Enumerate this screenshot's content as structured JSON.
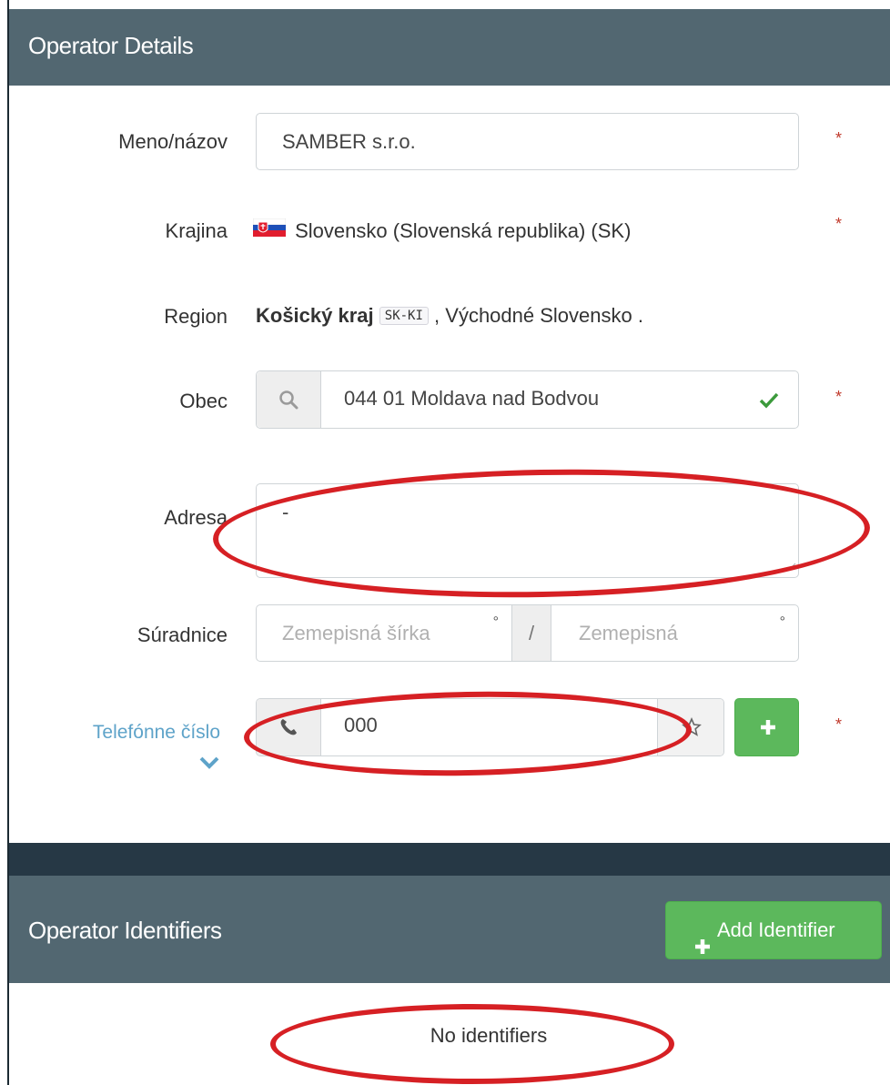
{
  "operator_details": {
    "title": "Operator Details",
    "name": {
      "label": "Meno/názov",
      "value": "SAMBER s.r.o.",
      "required_mark": "*"
    },
    "country": {
      "label": "Krajina",
      "value": "Slovensko (Slovenská republika) (SK)",
      "flag_icon": "slovakia-flag-icon",
      "required_mark": "*"
    },
    "region": {
      "label": "Region",
      "name": "Košický kraj",
      "code": "SK-KI",
      "suffix": ", Východné Slovensko ."
    },
    "municipality": {
      "label": "Obec",
      "value": "044 01 Moldava nad Bodvou",
      "search_icon": "search-icon",
      "valid_icon": "check-icon",
      "required_mark": "*"
    },
    "address": {
      "label": "Adresa",
      "value": "-"
    },
    "coordinates": {
      "label": "Súradnice",
      "lat_placeholder": "Zemepisná šírka",
      "lat_unit": "°",
      "separator": "/",
      "lon_placeholder": "Zemepisná",
      "lon_unit": "°"
    },
    "phone": {
      "label": "Telefónne číslo",
      "value": "000",
      "phone_icon": "phone-icon",
      "star_icon": "star-icon",
      "add_label": "+",
      "expand_icon": "chevron-down-icon",
      "required_mark": "*"
    }
  },
  "operator_identifiers": {
    "title": "Operator Identifiers",
    "add_button_label": "Add Identifier",
    "empty_text": "No identifiers"
  },
  "colors": {
    "header_bg": "#526771",
    "required": "#c0392b",
    "success_green": "#5cb85c",
    "link_blue": "#5ea3c9",
    "annotation_red": "#d62024"
  }
}
